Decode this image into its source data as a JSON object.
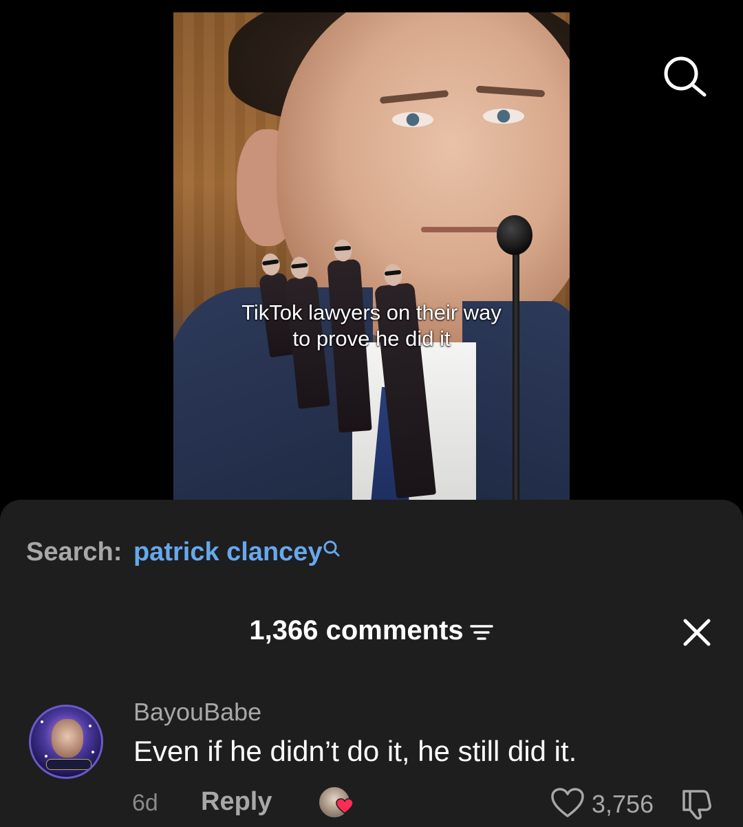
{
  "video": {
    "caption": "TikTok lawyers on their way\nto prove he did it"
  },
  "top_bar": {
    "search_icon": "search-icon"
  },
  "comments_sheet": {
    "search_label": "Search:",
    "search_term": "patrick clancey",
    "comment_count": "1,366 comments",
    "icons": {
      "filter": "filter-icon",
      "close": "close-icon"
    },
    "comments": [
      {
        "username": "BayouBabe",
        "text": "Even if he didn’t do it, he still did it.",
        "time": "6d",
        "reply_label": "Reply",
        "likes": "3,756"
      }
    ]
  },
  "colors": {
    "background": "#000000",
    "sheet": "#1e1e1e",
    "search_term": "#66a8ee",
    "creator_heart": "#fe2c55"
  }
}
